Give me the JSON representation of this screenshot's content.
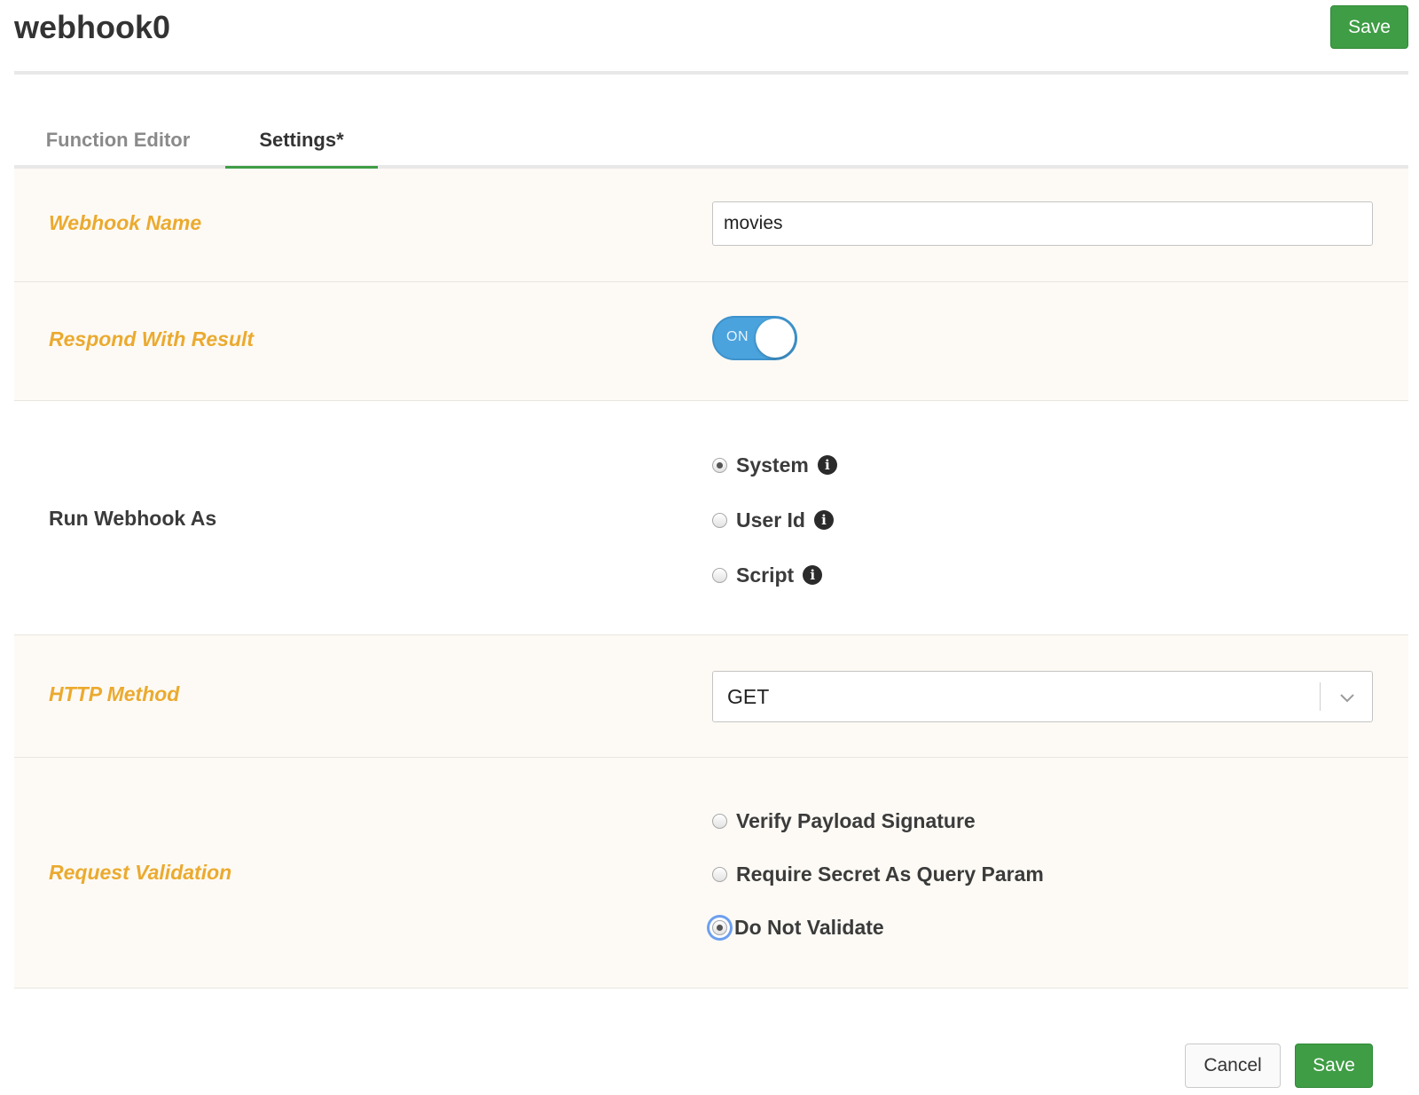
{
  "header": {
    "title": "webhook0",
    "save_label": "Save"
  },
  "tabs": [
    {
      "label": "Function Editor",
      "active": false
    },
    {
      "label": "Settings*",
      "active": true
    }
  ],
  "form": {
    "webhook_name": {
      "label": "Webhook Name",
      "value": "movies"
    },
    "respond_with_result": {
      "label": "Respond With Result",
      "toggle_text": "ON",
      "value": true
    },
    "run_webhook_as": {
      "label": "Run Webhook As",
      "options": [
        {
          "label": "System",
          "checked": true
        },
        {
          "label": "User Id",
          "checked": false
        },
        {
          "label": "Script",
          "checked": false
        }
      ]
    },
    "http_method": {
      "label": "HTTP Method",
      "value": "GET"
    },
    "request_validation": {
      "label": "Request Validation",
      "options": [
        {
          "label": "Verify Payload Signature",
          "checked": false
        },
        {
          "label": "Require Secret As Query Param",
          "checked": false
        },
        {
          "label": "Do Not Validate",
          "checked": true
        }
      ]
    }
  },
  "footer": {
    "cancel_label": "Cancel",
    "save_label": "Save"
  },
  "colors": {
    "accent_green": "#3f9d45",
    "required_label": "#ebaa2f",
    "toggle_on": "#4aa3dd"
  }
}
